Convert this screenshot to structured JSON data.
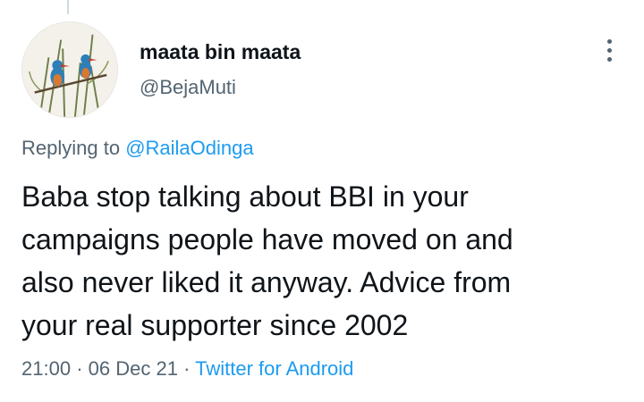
{
  "tweet": {
    "author": {
      "display_name": "maata bin maata",
      "handle": "@BejaMuti",
      "avatar_icon": "kingfisher-illustration-avatar"
    },
    "replying_prefix": "Replying to",
    "replying_to": "@RailaOdinga",
    "lines": [
      "Baba stop talking about BBI in your",
      "campaigns people have moved on and",
      "also never liked it anyway. Advice from",
      "your real supporter since 2002"
    ],
    "time": "21:00",
    "separator": "·",
    "date": "06 Dec 21",
    "source": "Twitter for Android"
  },
  "colors": {
    "text": "#0f1419",
    "secondary": "#536471",
    "link": "#1d9bf0",
    "thread_line": "#cfd9de"
  },
  "icons": {
    "more": "more-options-icon"
  }
}
